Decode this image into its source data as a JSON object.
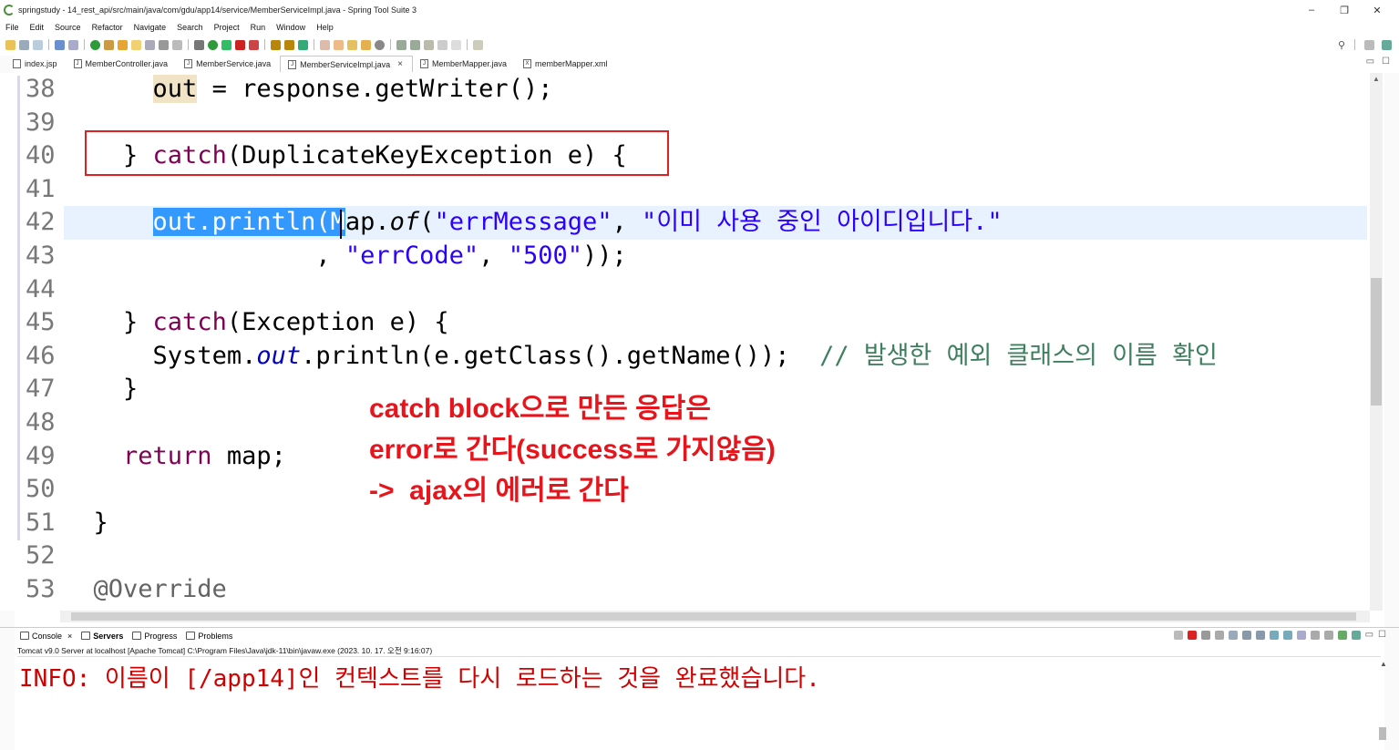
{
  "window": {
    "title": "springstudy - 14_rest_api/src/main/java/com/gdu/app14/service/MemberServiceImpl.java - Spring Tool Suite 3",
    "minimize": "–",
    "restore": "❐",
    "close": "✕"
  },
  "menu": [
    "File",
    "Edit",
    "Source",
    "Refactor",
    "Navigate",
    "Search",
    "Project",
    "Run",
    "Window",
    "Help"
  ],
  "tabs": [
    {
      "label": "index.jsp",
      "icon": "jsp-file-icon",
      "active": false
    },
    {
      "label": "MemberController.java",
      "icon": "java-file-icon",
      "active": false
    },
    {
      "label": "MemberService.java",
      "icon": "java-file-icon",
      "active": false
    },
    {
      "label": "MemberServiceImpl.java",
      "icon": "java-file-icon",
      "active": true
    },
    {
      "label": "MemberMapper.java",
      "icon": "java-file-icon",
      "active": false
    },
    {
      "label": "memberMapper.xml",
      "icon": "xml-file-icon",
      "active": false
    }
  ],
  "editor": {
    "line_numbers": [
      "38",
      "39",
      "40",
      "41",
      "42",
      "43",
      "44",
      "45",
      "46",
      "47",
      "48",
      "49",
      "50",
      "51",
      "52",
      "53"
    ],
    "code": {
      "l38_occ": "out",
      "l38_rest": " = response.getWriter();",
      "l40_brace": "} ",
      "l40_kw": "catch",
      "l40_rest": "(DuplicateKeyException e) {",
      "l42_sel": "out.println(M",
      "l42_rest1": "ap.",
      "l42_of": "of",
      "l42_rest2": "(",
      "l42_s1": "\"errMessage\"",
      "l42_comma": ", ",
      "l42_s2": "\"이미 사용 중인 아이디입니다.\"",
      "l43_comma": ", ",
      "l43_s1": "\"errCode\"",
      "l43_comma2": ", ",
      "l43_s2": "\"500\"",
      "l43_end": "));",
      "l45_brace": "} ",
      "l45_kw": "catch",
      "l45_rest": "(Exception e) {",
      "l46_sys": "System.",
      "l46_out": "out",
      "l46_rest": ".println(e.getClass().getName());  ",
      "l46_cmt": "// 발생한 예외 클래스의 이름 확인",
      "l47": "}",
      "l49_kw": "return",
      "l49_rest": " map;",
      "l51": "}",
      "l53": "@Override"
    }
  },
  "annotation": {
    "line1": "catch block으로 만든 응답은",
    "line2": "error로 간다(success로 가지않음)",
    "line3": "->  ajax의 에러로 간다"
  },
  "console": {
    "tabs": [
      {
        "label": "Console",
        "icon": "console-icon",
        "closable": true
      },
      {
        "label": "Servers",
        "icon": "servers-icon",
        "active": true
      },
      {
        "label": "Progress",
        "icon": "progress-icon"
      },
      {
        "label": "Problems",
        "icon": "problems-icon"
      }
    ],
    "description": "Tomcat v9.0 Server at localhost [Apache Tomcat] C:\\Program Files\\Java\\jdk-11\\bin\\javaw.exe  (2023. 10. 17. 오전 9:16:07)",
    "output": "INFO: 이름이 [/app14]인 컨텍스트를 다시 로드하는 것을 완료했습니다."
  },
  "colors": {
    "keyword": "#7f0055",
    "string": "#2a00ff",
    "comment": "#3f7f5f",
    "field": "#0000c0",
    "selection": "#3399ff",
    "current_line": "#e8f2fe",
    "annotation": "#e8141c",
    "console_output": "#d00000",
    "highlight_box": "#e02020"
  }
}
